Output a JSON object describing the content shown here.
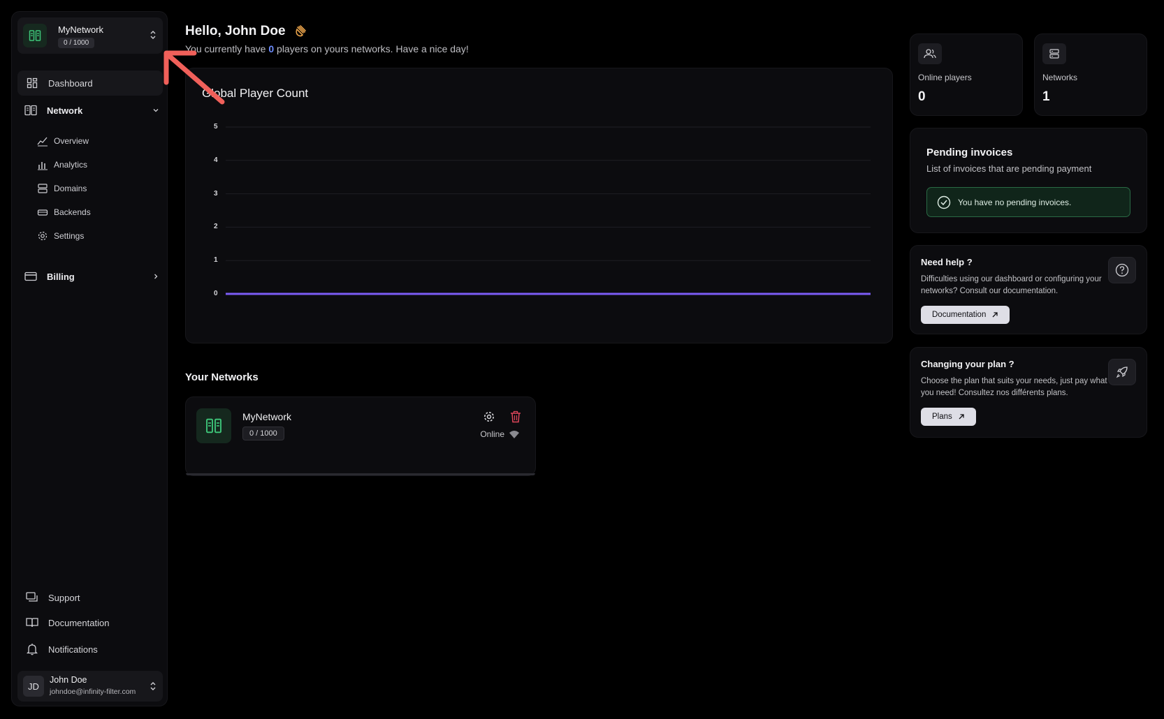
{
  "sidebar": {
    "network_switcher": {
      "name": "MyNetwork",
      "usage": "0 / 1000"
    },
    "nav": {
      "dashboard": "Dashboard",
      "network": "Network",
      "network_sub": [
        "Overview",
        "Analytics",
        "Domains",
        "Backends",
        "Settings"
      ],
      "billing": "Billing"
    },
    "bottom": {
      "support": "Support",
      "documentation": "Documentation",
      "notifications": "Notifications"
    },
    "user": {
      "initials": "JD",
      "name": "John Doe",
      "email": "johndoe@infinity-filter.com"
    }
  },
  "header": {
    "greeting": "Hello, John Doe",
    "sub_prefix": "You currently have",
    "player_count": "0",
    "sub_suffix": "players on yours networks. Have a nice day!"
  },
  "chart_data": {
    "type": "line",
    "title": "Global Player Count",
    "ylim": [
      0,
      5
    ],
    "yticks": [
      "5",
      "4",
      "3",
      "2",
      "1",
      "0"
    ],
    "series": [
      {
        "values": [
          0,
          0,
          0,
          0,
          0,
          0,
          0,
          0,
          0,
          0
        ]
      }
    ],
    "grid": true,
    "color": "#7c5cf5"
  },
  "your_networks": {
    "title": "Your Networks",
    "items": [
      {
        "name": "MyNetwork",
        "usage": "0 / 1000",
        "status": "Online"
      }
    ]
  },
  "stats": {
    "online_players": {
      "label": "Online players",
      "value": "0"
    },
    "networks": {
      "label": "Networks",
      "value": "1"
    }
  },
  "invoices": {
    "title": "Pending invoices",
    "desc": "List of invoices that are pending payment",
    "empty": "You have no pending invoices."
  },
  "help": {
    "title": "Need help ?",
    "desc": "Difficulties using our dashboard or configuring your networks? Consult our documentation.",
    "button": "Documentation"
  },
  "plan": {
    "title": "Changing your plan ?",
    "desc": "Choose the plan that suits your needs, just pay what you need! Consultez nos différents plans.",
    "button": "Plans"
  },
  "colors": {
    "accent": "#6d8dff",
    "success": "#2a6a45",
    "danger": "#e0455a",
    "brand_green": "#3ec77a",
    "annotation_arrow": "#f0605a"
  }
}
